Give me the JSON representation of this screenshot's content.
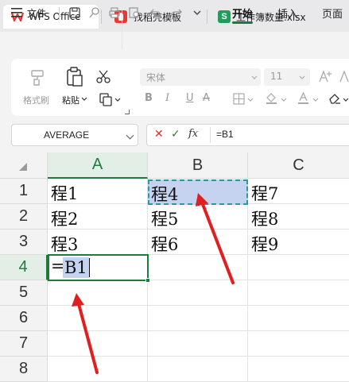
{
  "tabs": [
    {
      "label": "WPS Office"
    },
    {
      "label": "找稻壳模板"
    },
    {
      "label": "工作簿数量.xlsx"
    }
  ],
  "menu": {
    "file": "文件",
    "kaishi": "开始",
    "charu": "插入",
    "yemian": "页面"
  },
  "ribbon": {
    "format_painter": "格式刷",
    "paste": "粘贴",
    "font": "宋体",
    "size": "11"
  },
  "formula_bar": {
    "name_box": "AVERAGE",
    "formula": "=B1"
  },
  "columns": [
    "A",
    "B",
    "C"
  ],
  "rows": [
    "1",
    "2",
    "3",
    "4",
    "5",
    "6",
    "7",
    "8"
  ],
  "cells": {
    "A1": "程1",
    "A2": "程2",
    "A3": "程3",
    "B1": "程4",
    "B2": "程5",
    "B3": "程6",
    "C1": "程7",
    "C2": "程8",
    "C3": "程9",
    "A4_eq": "=",
    "A4_ref": "B1"
  },
  "colors": {
    "accent": "#1f7a3e",
    "ref_highlight": "#c5d2f0",
    "arrow": "#e02020"
  }
}
